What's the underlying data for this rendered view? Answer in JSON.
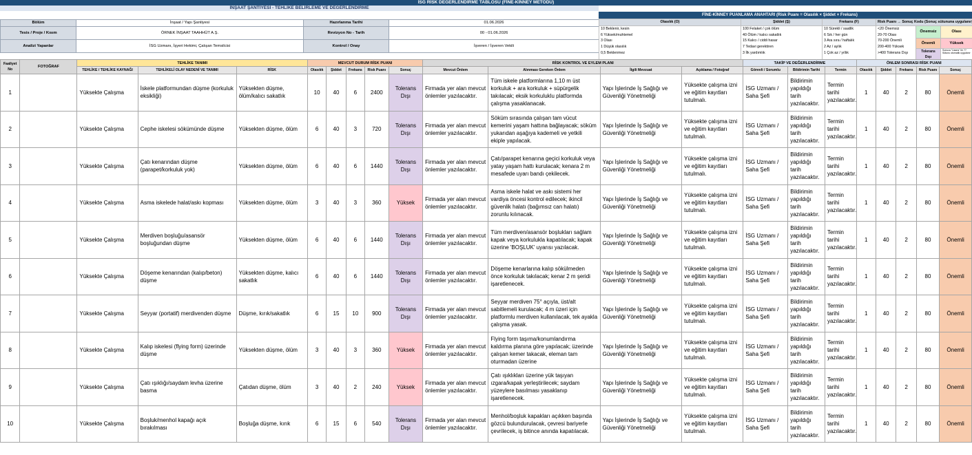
{
  "title": "İSG RİSK DEĞERLENDİRME TABLOSU (FİNE-KİNNEY METODU)",
  "subtitle": "İNŞAAT ŞANTİYESİ - TEHLİKE BELİRLEME VE DEĞERLENDİRME",
  "legend_title": "FİNE-KİNNEY PUANLAMA ANAHTARI  (Risk Puanı = Olasılık × Şiddet × Frekans)",
  "meta": {
    "bolum_label": "Bölüm",
    "bolum_value": "İnşaat / Yapı Şantiyesi",
    "hazirlanma_label": "Hazırlanma Tarihi",
    "hazirlanma_value": "01.06.2026",
    "tesis_label": "Tesis / Proje / Kısım",
    "tesis_value": "ÖRNEK İNŞAAT TAAHHÜT A.Ş.",
    "revizyon_label": "Revizyon No - Tarih",
    "revizyon_value": "00 - 01.06.2026",
    "analiz_label": "Analizi Yapanlar",
    "analiz_value": "İSG Uzmanı, İşyeri Hekimi, Çalışan Temsilcisi",
    "kontrol_label": "Kontrol / Onay",
    "kontrol_value": "İşveren / İşveren Vekili"
  },
  "legend": {
    "headers": [
      "Olasılık (O)",
      "Şiddet (Ş)",
      "Frekans (F)",
      "Risk Puanı → Sonuç Kodu (Sonuç sütununa uygulanır)"
    ],
    "olasilik": [
      "10  Beklenir, kesin",
      "6  Yüksek/muhtemel",
      "3  Olası",
      "1  Düşük olasılık",
      "0,5  Beklenmez"
    ],
    "siddet": [
      "100  Felaket / çok ölüm",
      "40  Ölüm / kalıcı sakatlık",
      "15  Kalıcı / ciddi hasar",
      "7  Tedavi gerektiren",
      "3  İlk yardımlık"
    ],
    "frekans": [
      "10  Sürekli / saatlik",
      "6  Sık / her gün",
      "3  Ara sıra / haftalık",
      "2  Az / aylık",
      "1  Çok az / yıllık"
    ],
    "puan": [
      "<20  Önemsiz",
      "20-70  Olası",
      "70-200  Önemli",
      "200-400  Yüksek",
      ">400  Tolerans Dışı"
    ],
    "tags": [
      "Önemsiz",
      "Olası",
      "Önemli",
      "Yüksek",
      "Tolerans Dışı"
    ],
    "note": "Sonuca \"Lisans\" ile ??\nSütunu otomatik uygulanır"
  },
  "groups": {
    "tehlike": "TEHLİKE TANIMI",
    "mevcut": "MEVCUT DURUM RİSK PUANI",
    "kontrol": "RİSK KONTROL VE EYLEM PLANI",
    "takip": "TAKİP VE DEĞERLENDİRME",
    "sonra": "ÖNLEM SONRASI RİSK PUANI"
  },
  "columns": {
    "no": "Faaliyet No",
    "foto": "FOTOĞRAF",
    "kaynak": "TEHLİKE / TEHLİKE KAYNAĞI",
    "olay": "TEHLİKELİ OLAY NEDENİ VE TANIMI",
    "risk": "RİSK",
    "o": "Olasılık",
    "s": "Şiddet",
    "f": "Frekans",
    "rp": "Risk Puanı",
    "sonuc": "Sonuç",
    "mevcut": "Mevcut Önlem",
    "alinmasi": "Alınması Gereken Önlem",
    "mevzuat": "İlgili Mevzuat",
    "aciklama": "Açıklama / Fotoğraf",
    "gorevli": "Görevli / Sorumlu",
    "bildirim": "Bildirimin Tarihi",
    "termin": "Termin",
    "o2": "Olasılık",
    "s2": "Şiddet",
    "f2": "Frekans",
    "rp2": "Risk Puanı",
    "sonuc2": "Sonuç"
  },
  "rows": [
    {
      "no": "1",
      "kaynak": "Yüksekte Çalışma",
      "olay": "İskele platformundan düşme (korkuluk eksikliği)",
      "risk": "Yüksekten düşme, ölüm/kalıcı sakatlık",
      "o": "10",
      "s": "40",
      "f": "6",
      "rp": "2400",
      "sonuc": "Tolerans Dışı",
      "mevcut": "Firmada yer alan mevcut önlemler yazılacaktır.",
      "alinmasi": "Tüm iskele platformlarına 1,10 m üst korkuluk + ara korkuluk + süpürgelik takılacak; eksik korkuluklu platformda çalışma yasaklanacak.",
      "mevzuat": "Yapı İşlerinde İş Sağlığı ve Güvenliği Yönetmeliği",
      "aciklama": "Yüksekte çalışma izni ve eğitim kayıtları tutulmalı.",
      "gorevli": "İSG Uzmanı / Saha Şefi",
      "bildirim": "Bildirimin yapıldığı tarih yazılacaktır.",
      "termin": "Termin tarihi yazılacaktır.",
      "o2": "1",
      "s2": "40",
      "f2": "2",
      "rp2": "80",
      "sonuc2": "Önemli"
    },
    {
      "no": "2",
      "kaynak": "Yüksekte Çalışma",
      "olay": "Cephe iskelesi sökümünde düşme",
      "risk": "Yüksekten düşme, ölüm",
      "o": "6",
      "s": "40",
      "f": "3",
      "rp": "720",
      "sonuc": "Tolerans Dışı",
      "mevcut": "Firmada yer alan mevcut önlemler yazılacaktır.",
      "alinmasi": "Söküm sırasında çalışan tam vücut kemerini yaşam hattına bağlayacak; söküm yukarıdan aşağıya kademeli ve yetkili ekiple yapılacak.",
      "mevzuat": "Yapı İşlerinde İş Sağlığı ve Güvenliği Yönetmeliği",
      "aciklama": "Yüksekte çalışma izni ve eğitim kayıtları tutulmalı.",
      "gorevli": "İSG Uzmanı / Saha Şefi",
      "bildirim": "Bildirimin yapıldığı tarih yazılacaktır.",
      "termin": "Termin tarihi yazılacaktır.",
      "o2": "1",
      "s2": "40",
      "f2": "2",
      "rp2": "80",
      "sonuc2": "Önemli"
    },
    {
      "no": "3",
      "kaynak": "Yüksekte Çalışma",
      "olay": "Çatı kenarından düşme (parapet/korkuluk yok)",
      "risk": "Yüksekten düşme, ölüm",
      "o": "6",
      "s": "40",
      "f": "6",
      "rp": "1440",
      "sonuc": "Tolerans Dışı",
      "mevcut": "Firmada yer alan mevcut önlemler yazılacaktır.",
      "alinmasi": "Çatı/parapet kenarına geçici korkuluk veya yatay yaşam hattı kurulacak; kenara 2 m mesafede uyarı bandı çekilecek.",
      "mevzuat": "Yapı İşlerinde İş Sağlığı ve Güvenliği Yönetmeliği",
      "aciklama": "Yüksekte çalışma izni ve eğitim kayıtları tutulmalı.",
      "gorevli": "İSG Uzmanı / Saha Şefi",
      "bildirim": "Bildirimin yapıldığı tarih yazılacaktır.",
      "termin": "Termin tarihi yazılacaktır.",
      "o2": "1",
      "s2": "40",
      "f2": "2",
      "rp2": "80",
      "sonuc2": "Önemli"
    },
    {
      "no": "4",
      "kaynak": "Yüksekte Çalışma",
      "olay": "Asma iskelede halat/askı kopması",
      "risk": "Yüksekten düşme, ölüm",
      "o": "3",
      "s": "40",
      "f": "3",
      "rp": "360",
      "sonuc": "Yüksek",
      "mevcut": "Firmada yer alan mevcut önlemler yazılacaktır.",
      "alinmasi": "Asma iskele halat ve askı sistemi her vardiya öncesi kontrol edilecek; ikincil güvenlik halatı (bağımsız can halatı) zorunlu kılınacak.",
      "mevzuat": "Yapı İşlerinde İş Sağlığı ve Güvenliği Yönetmeliği",
      "aciklama": "Yüksekte çalışma izni ve eğitim kayıtları tutulmalı.",
      "gorevli": "İSG Uzmanı / Saha Şefi",
      "bildirim": "Bildirimin yapıldığı tarih yazılacaktır.",
      "termin": "Termin tarihi yazılacaktır.",
      "o2": "1",
      "s2": "40",
      "f2": "2",
      "rp2": "80",
      "sonuc2": "Önemli"
    },
    {
      "no": "5",
      "kaynak": "Yüksekte Çalışma",
      "olay": "Merdiven boşluğu/asansör boşluğundan düşme",
      "risk": "Yüksekten düşme, ölüm",
      "o": "6",
      "s": "40",
      "f": "6",
      "rp": "1440",
      "sonuc": "Tolerans Dışı",
      "mevcut": "Firmada yer alan mevcut önlemler yazılacaktır.",
      "alinmasi": "Tüm merdiven/asansör boşlukları sağlam kapak veya korkulukla kapatılacak; kapak üzerine 'BOŞLUK' uyarısı yazılacak.",
      "mevzuat": "Yapı İşlerinde İş Sağlığı ve Güvenliği Yönetmeliği",
      "aciklama": "Yüksekte çalışma izni ve eğitim kayıtları tutulmalı.",
      "gorevli": "İSG Uzmanı / Saha Şefi",
      "bildirim": "Bildirimin yapıldığı tarih yazılacaktır.",
      "termin": "Termin tarihi yazılacaktır.",
      "o2": "1",
      "s2": "40",
      "f2": "2",
      "rp2": "80",
      "sonuc2": "Önemli"
    },
    {
      "no": "6",
      "kaynak": "Yüksekte Çalışma",
      "olay": "Döşeme kenarından (kalıp/beton) düşme",
      "risk": "Yüksekten düşme, kalıcı sakatlık",
      "o": "6",
      "s": "40",
      "f": "6",
      "rp": "1440",
      "sonuc": "Tolerans Dışı",
      "mevcut": "Firmada yer alan mevcut önlemler yazılacaktır.",
      "alinmasi": "Döşeme kenarlarına kalıp sökülmeden önce korkuluk takılacak; kenar 2 m şeridi işaretlenecek.",
      "mevzuat": "Yapı İşlerinde İş Sağlığı ve Güvenliği Yönetmeliği",
      "aciklama": "Yüksekte çalışma izni ve eğitim kayıtları tutulmalı.",
      "gorevli": "İSG Uzmanı / Saha Şefi",
      "bildirim": "Bildirimin yapıldığı tarih yazılacaktır.",
      "termin": "Termin tarihi yazılacaktır.",
      "o2": "1",
      "s2": "40",
      "f2": "2",
      "rp2": "80",
      "sonuc2": "Önemli"
    },
    {
      "no": "7",
      "kaynak": "Yüksekte Çalışma",
      "olay": "Seyyar (portatif) merdivenden düşme",
      "risk": "Düşme, kırık/sakatlık",
      "o": "6",
      "s": "15",
      "f": "10",
      "rp": "900",
      "sonuc": "Tolerans Dışı",
      "mevcut": "Firmada yer alan mevcut önlemler yazılacaktır.",
      "alinmasi": "Seyyar merdiven 75° açıyla, üst/alt sabitlemeli kurulacak; 4 m üzeri için platformlu merdiven kullanılacak, tek ayakla çalışma yasak.",
      "mevzuat": "Yapı İşlerinde İş Sağlığı ve Güvenliği Yönetmeliği",
      "aciklama": "Yüksekte çalışma izni ve eğitim kayıtları tutulmalı.",
      "gorevli": "İSG Uzmanı / Saha Şefi",
      "bildirim": "Bildirimin yapıldığı tarih yazılacaktır.",
      "termin": "Termin tarihi yazılacaktır.",
      "o2": "1",
      "s2": "40",
      "f2": "2",
      "rp2": "80",
      "sonuc2": "Önemli"
    },
    {
      "no": "8",
      "kaynak": "Yüksekte Çalışma",
      "olay": "Kalıp iskelesi (flying form) üzerinde düşme",
      "risk": "Yüksekten düşme, ölüm",
      "o": "3",
      "s": "40",
      "f": "3",
      "rp": "360",
      "sonuc": "Yüksek",
      "mevcut": "Firmada yer alan mevcut önlemler yazılacaktır.",
      "alinmasi": "Flying form taşıma/konumlandırma kaldırma planına göre yapılacak; üzerinde çalışan kemer takacak, eleman tam oturmadan üzerine",
      "mevzuat": "Yapı İşlerinde İş Sağlığı ve Güvenliği Yönetmeliği",
      "aciklama": "Yüksekte çalışma izni ve eğitim kayıtları tutulmalı.",
      "gorevli": "İSG Uzmanı / Saha Şefi",
      "bildirim": "Bildirimin yapıldığı tarih yazılacaktır.",
      "termin": "Termin tarihi yazılacaktır.",
      "o2": "1",
      "s2": "40",
      "f2": "2",
      "rp2": "80",
      "sonuc2": "Önemli"
    },
    {
      "no": "9",
      "kaynak": "Yüksekte Çalışma",
      "olay": "Çatı ışıklığı/saydam levha üzerine basma",
      "risk": "Çatıdan düşme, ölüm",
      "o": "3",
      "s": "40",
      "f": "2",
      "rp": "240",
      "sonuc": "Yüksek",
      "mevcut": "Firmada yer alan mevcut önlemler yazılacaktır.",
      "alinmasi": "Çatı ışıklıkları üzerine yük taşıyan ızgara/kapak yerleştirilecek; saydam yüzeylere basılması yasaklanıp işaretlenecek.",
      "mevzuat": "Yapı İşlerinde İş Sağlığı ve Güvenliği Yönetmeliği",
      "aciklama": "Yüksekte çalışma izni ve eğitim kayıtları tutulmalı.",
      "gorevli": "İSG Uzmanı / Saha Şefi",
      "bildirim": "Bildirimin yapıldığı tarih yazılacaktır.",
      "termin": "Termin tarihi yazılacaktır.",
      "o2": "1",
      "s2": "40",
      "f2": "2",
      "rp2": "80",
      "sonuc2": "Önemli"
    },
    {
      "no": "10",
      "kaynak": "Yüksekte Çalışma",
      "olay": "Boşluk/menhol kapağı açık bırakılması",
      "risk": "Boşluğa düşme, kırık",
      "o": "6",
      "s": "15",
      "f": "6",
      "rp": "540",
      "sonuc": "Tolerans Dışı",
      "mevcut": "Firmada yer alan mevcut önlemler yazılacaktır.",
      "alinmasi": "Menhol/boşluk kapakları açıkken başında gözcü bulundurulacak, çevresi bariyerle çevrilecek, iş bitince anında kapatılacak.",
      "mevzuat": "Yapı İşlerinde İş Sağlığı ve Güvenliği Yönetmeliği",
      "aciklama": "Yüksekte çalışma izni ve eğitim kayıtları tutulmalı.",
      "gorevli": "İSG Uzmanı / Saha Şefi",
      "bildirim": "Bildirimin yapıldığı tarih yazılacaktır.",
      "termin": "Termin tarihi yazılacaktır.",
      "o2": "1",
      "s2": "40",
      "f2": "2",
      "rp2": "80",
      "sonuc2": "Önemli"
    }
  ],
  "colors": {
    "header_blue": "#1f4e79",
    "tolerans": "#ddd0e9",
    "yuksek": "#ffc7ce",
    "onemli": "#f8cbad"
  }
}
